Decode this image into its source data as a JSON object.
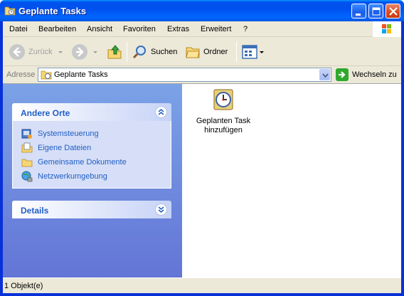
{
  "window": {
    "title": "Geplante Tasks"
  },
  "menu": {
    "items": [
      "Datei",
      "Bearbeiten",
      "Ansicht",
      "Favoriten",
      "Extras",
      "Erweitert",
      "?"
    ]
  },
  "toolbar": {
    "back_label": "Zurück",
    "search_label": "Suchen",
    "folders_label": "Ordner"
  },
  "address": {
    "label": "Adresse",
    "value": "Geplante Tasks",
    "go_label": "Wechseln zu"
  },
  "taskpane": {
    "other_places": {
      "title": "Andere Orte",
      "links": [
        "Systemsteuerung",
        "Eigene Dateien",
        "Gemeinsame Dokumente",
        "Netzwerkumgebung"
      ]
    },
    "details": {
      "title": "Details"
    }
  },
  "files": [
    {
      "label_line1": "Geplanten Task",
      "label_line2": "hinzufügen",
      "icon": "scheduled-task-icon"
    }
  ],
  "status": {
    "text": "1 Objekt(e)"
  },
  "colors": {
    "titlebar": "#0054e3",
    "taskpane_top": "#7ba2e7",
    "taskpane_bottom": "#6375d6",
    "link": "#215dc6",
    "chrome": "#ece9d8"
  }
}
